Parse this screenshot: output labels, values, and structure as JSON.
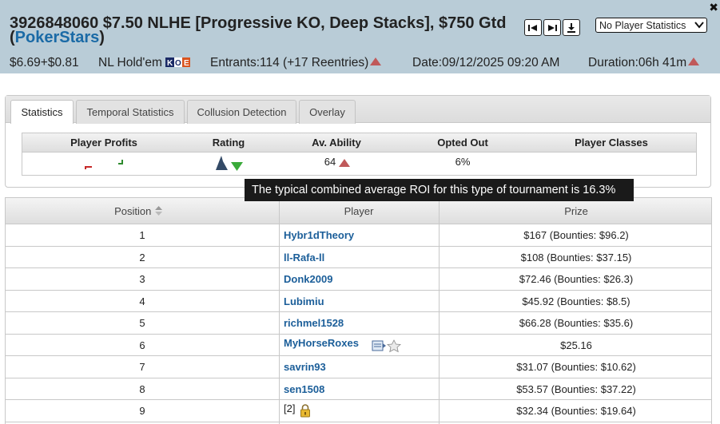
{
  "header": {
    "title_line1": "3926848060 $7.50 NLHE [Progressive KO, Deep Stacks], $750 Gtd",
    "title_paren_open": "(",
    "site": "PokerStars",
    "title_paren_close": ")",
    "buyin": "$6.69+$0.81",
    "game": "NL Hold'em",
    "entrants": "Entrants:114 (+17 Reentries)",
    "date": "Date:09/12/2025 09:20 AM",
    "duration": "Duration:06h 41m",
    "stats_select": "No Player Statistics",
    "ko_badge": "KO"
  },
  "tabs": [
    {
      "label": "Statistics",
      "active": true
    },
    {
      "label": "Temporal Statistics",
      "active": false
    },
    {
      "label": "Collusion Detection",
      "active": false
    },
    {
      "label": "Overlay",
      "active": false
    }
  ],
  "stats": {
    "headers": [
      "Player Profits",
      "Rating",
      "Av. Ability",
      "Opted Out",
      "Player Classes"
    ],
    "av_ability": "64",
    "opted_out": "6%"
  },
  "tooltip": "The typical combined average ROI for this type of tournament is 16.3%",
  "results": {
    "headers": [
      "Position",
      "Player",
      "Prize"
    ],
    "rows": [
      {
        "pos": "1",
        "player": "Hybr1dTheory",
        "prize": "$167  (Bounties: $96.2)"
      },
      {
        "pos": "2",
        "player": "ll-Rafa-ll",
        "prize": "$108  (Bounties: $37.15)"
      },
      {
        "pos": "3",
        "player": "Donk2009",
        "prize": "$72.46  (Bounties: $26.3)"
      },
      {
        "pos": "4",
        "player": "Lubimiu",
        "prize": "$45.92  (Bounties: $8.5)"
      },
      {
        "pos": "5",
        "player": "richmel1528",
        "prize": "$66.28  (Bounties: $35.6)"
      },
      {
        "pos": "6",
        "player": "MyHorseRoxes",
        "prize": "$25.16"
      },
      {
        "pos": "7",
        "player": "savrin93",
        "prize": "$31.07  (Bounties: $10.62)"
      },
      {
        "pos": "8",
        "player": "sen1508",
        "prize": "$53.57  (Bounties: $37.22)"
      },
      {
        "pos": "9",
        "player": "[2]",
        "prize": "$32.34  (Bounties: $19.64)"
      }
    ]
  },
  "colors": {
    "header_bg": "#b9ccd7",
    "link": "#1b5e99",
    "up_arrow": "#c0595a",
    "down_arrow": "#3aaa3a"
  }
}
